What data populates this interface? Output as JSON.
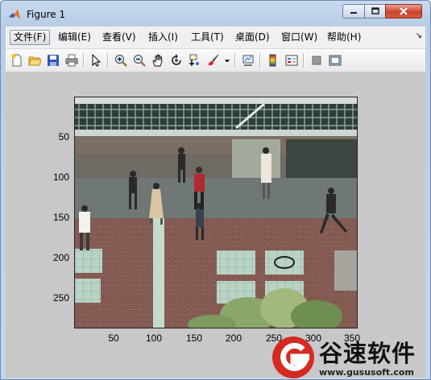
{
  "window": {
    "title": "Figure 1",
    "controls": {
      "minimize": "minimize",
      "maximize": "maximize",
      "close": "close"
    }
  },
  "menubar": {
    "items": [
      {
        "label": "文件(F)"
      },
      {
        "label": "编辑(E)"
      },
      {
        "label": "查看(V)"
      },
      {
        "label": "插入(I)"
      },
      {
        "label": "工具(T)"
      },
      {
        "label": "桌面(D)"
      },
      {
        "label": "窗口(W)"
      },
      {
        "label": "帮助(H)"
      }
    ],
    "dock_arrow": "↘"
  },
  "toolbar": {
    "icons": [
      "new-figure-icon",
      "open-file-icon",
      "save-icon",
      "print-icon",
      "edit-plot-arrow-icon",
      "zoom-in-icon",
      "zoom-out-icon",
      "pan-hand-icon",
      "rotate-3d-icon",
      "data-cursor-icon",
      "brush-icon",
      "link-plot-icon",
      "colorbar-icon",
      "legend-icon",
      "hide-plot-tools-icon",
      "show-plot-tools-icon"
    ]
  },
  "axes": {
    "yticks": [
      "50",
      "100",
      "150",
      "200",
      "250"
    ],
    "xticks": [
      "50",
      "100",
      "150",
      "200",
      "250",
      "300",
      "350"
    ],
    "image": "surveillance frame: pedestrians walking on brick plaza"
  },
  "watermark": {
    "name": "谷速软件",
    "url": "www.gususoft.com"
  },
  "colors": {
    "titlebar": "#c9d9ee",
    "close_button": "#c8432c",
    "figure_bg": "#c8c8c8",
    "watermark_red": "#d42a20"
  }
}
